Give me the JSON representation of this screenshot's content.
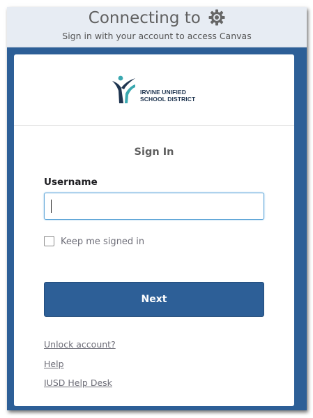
{
  "header": {
    "title": "Connecting to",
    "icon": "gear-icon",
    "subtitle": "Sign in with your account to access Canvas"
  },
  "logo": {
    "line1": "IRVINE UNIFIED",
    "line2": "SCHOOL DISTRICT",
    "colors": {
      "navy": "#1f3550",
      "teal": "#3aa8b0"
    }
  },
  "form": {
    "title": "Sign In",
    "username_label": "Username",
    "username_value": "",
    "keep_signed_in_label": "Keep me signed in",
    "keep_signed_in_checked": false,
    "next_label": "Next"
  },
  "links": {
    "unlock": "Unlock account?",
    "help": "Help",
    "helpdesk": "IUSD Help Desk"
  },
  "colors": {
    "frame": "#2d5f97",
    "header_bg": "#e7ecf3",
    "input_focus": "#5fa6d8"
  }
}
